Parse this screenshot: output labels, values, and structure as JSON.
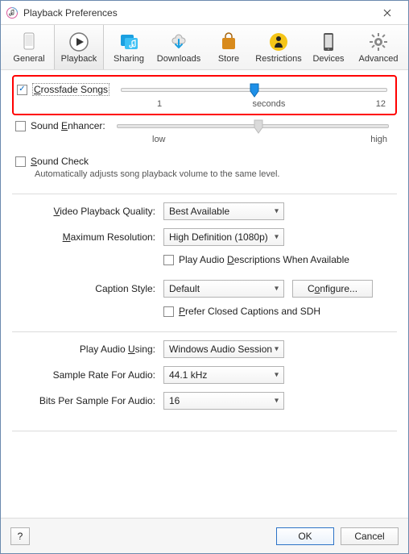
{
  "window": {
    "title": "Playback Preferences"
  },
  "toolbar": {
    "general": "General",
    "playback": "Playback",
    "sharing": "Sharing",
    "downloads": "Downloads",
    "store": "Store",
    "restrictions": "Restrictions",
    "devices": "Devices",
    "advanced": "Advanced"
  },
  "crossfade": {
    "label": "Crossfade Songs",
    "checked": true,
    "min_label": "1",
    "unit_label": "seconds",
    "max_label": "12",
    "value_percent": 48
  },
  "sound_enhancer": {
    "label": "Sound Enhancer:",
    "checked": false,
    "low_label": "low",
    "high_label": "high",
    "value_percent": 50
  },
  "sound_check": {
    "label": "Sound Check",
    "checked": false,
    "description": "Automatically adjusts song playback volume to the same level."
  },
  "video": {
    "quality_label": "Video Playback Quality:",
    "quality_value": "Best Available",
    "max_res_label": "Maximum Resolution:",
    "max_res_value": "High Definition (1080p)",
    "audio_desc_label": "Play Audio Descriptions When Available",
    "audio_desc_checked": false
  },
  "caption": {
    "label": "Caption Style:",
    "value": "Default",
    "configure_label": "Configure...",
    "prefer_cc_label": "Prefer Closed Captions and SDH",
    "prefer_cc_checked": false
  },
  "audio": {
    "play_using_label": "Play Audio Using:",
    "play_using_value": "Windows Audio Session",
    "sample_rate_label": "Sample Rate For Audio:",
    "sample_rate_value": "44.1 kHz",
    "bits_label": "Bits Per Sample For Audio:",
    "bits_value": "16"
  },
  "footer": {
    "help_label": "?",
    "ok_label": "OK",
    "cancel_label": "Cancel"
  }
}
